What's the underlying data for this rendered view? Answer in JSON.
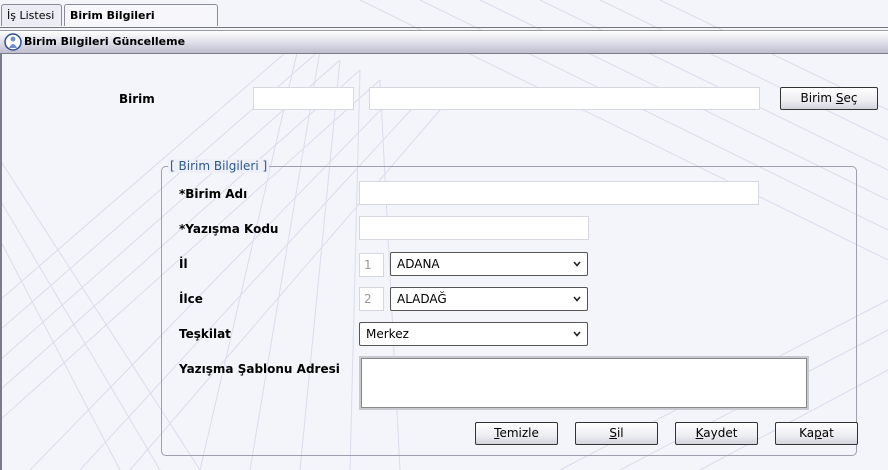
{
  "tabs": [
    {
      "label": "İş Listesi"
    },
    {
      "label": "Birim Bilgileri Güncelleme"
    }
  ],
  "title": "Birim Bilgileri Güncelleme",
  "birim": {
    "label": "Birim",
    "code_value": "",
    "name_value": "",
    "select_button": {
      "pre": "Birim ",
      "accel": "S",
      "post": "eç"
    }
  },
  "group": {
    "legend": "[ Birim Bilgileri ]",
    "birim_adi": {
      "label": "*Birim Adı",
      "value": ""
    },
    "yazisma_kodu": {
      "label": "*Yazışma Kodu",
      "value": ""
    },
    "il": {
      "label": "İl",
      "code": "1",
      "selected": "ADANA"
    },
    "ilce": {
      "label": "İlce",
      "code": "2",
      "selected": "ALADAĞ"
    },
    "teskilat": {
      "label": "Teşkilat",
      "selected": "Merkez"
    },
    "sablon": {
      "label": "Yazışma Şablonu Adresi",
      "value": ""
    }
  },
  "buttons": {
    "temizle": {
      "pre": "",
      "accel": "T",
      "post": "emizle"
    },
    "sil": {
      "pre": "",
      "accel": "S",
      "post": "il"
    },
    "kaydet": {
      "pre": "",
      "accel": "K",
      "post": "aydet"
    },
    "kapat": {
      "pre": "Ka",
      "accel": "p",
      "post": "at"
    }
  },
  "colors": {
    "background": "#f6f6fc",
    "legend_text": "#2b5a8c",
    "title_gradient_bottom": "#bdbdcc"
  },
  "icons": {
    "title": "user-info-icon",
    "dropdown": "chevron-down-icon"
  }
}
